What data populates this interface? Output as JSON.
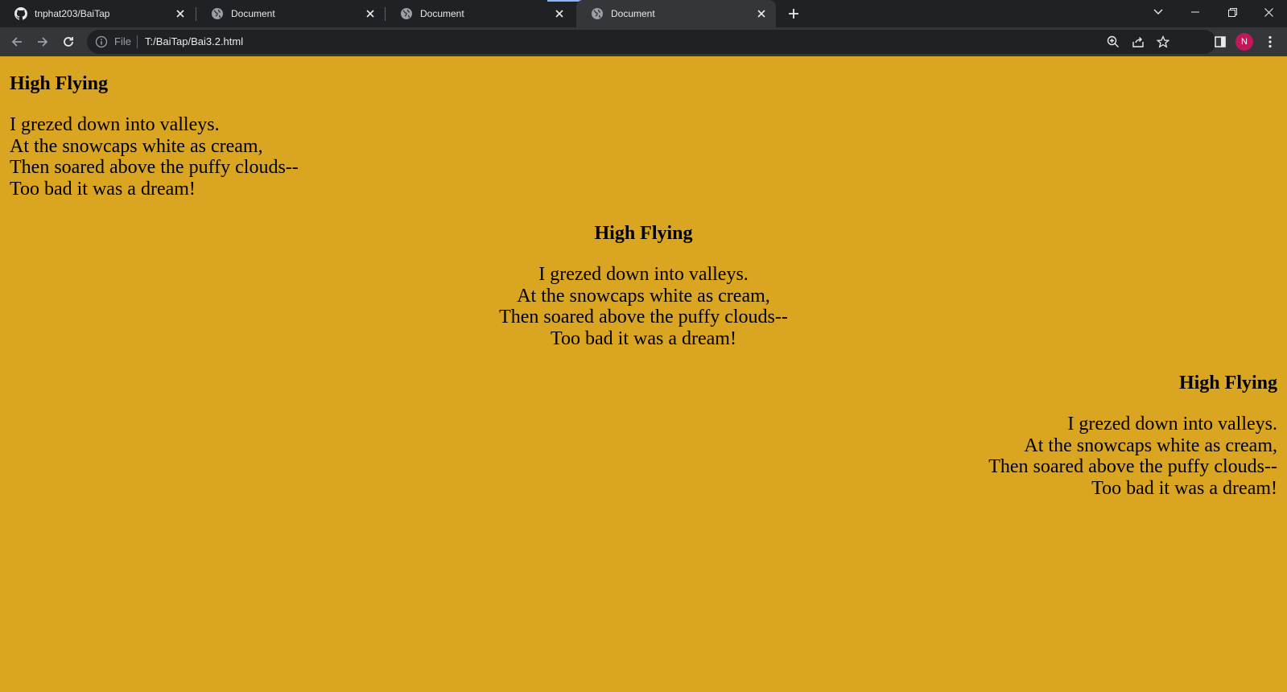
{
  "browser": {
    "tabs": [
      {
        "title": "tnphat203/BaiTap",
        "icon": "github-icon",
        "active": false
      },
      {
        "title": "Document",
        "icon": "globe-icon",
        "active": false
      },
      {
        "title": "Document",
        "icon": "globe-icon",
        "active": false
      },
      {
        "title": "Document",
        "icon": "globe-icon",
        "active": true
      }
    ],
    "address": {
      "scheme_label": "File",
      "url": "T:/BaiTap/Bai3.2.html"
    },
    "profile_initial": "N"
  },
  "page": {
    "background": "#DAA520",
    "poems": [
      {
        "align": "left",
        "title": "High Flying",
        "lines": [
          "I grezed down into valleys.",
          "At the snowcaps white as cream,",
          "Then soared above the puffy clouds--",
          "Too bad it was a dream!"
        ]
      },
      {
        "align": "center",
        "title": "High Flying",
        "lines": [
          "I grezed down into valleys.",
          "At the snowcaps white as cream,",
          "Then soared above the puffy clouds--",
          "Too bad it was a dream!"
        ]
      },
      {
        "align": "right",
        "title": "High Flying",
        "lines": [
          "I grezed down into valleys.",
          "At the snowcaps white as cream,",
          "Then soared above the puffy clouds--",
          "Too bad it was a dream!"
        ]
      }
    ]
  }
}
